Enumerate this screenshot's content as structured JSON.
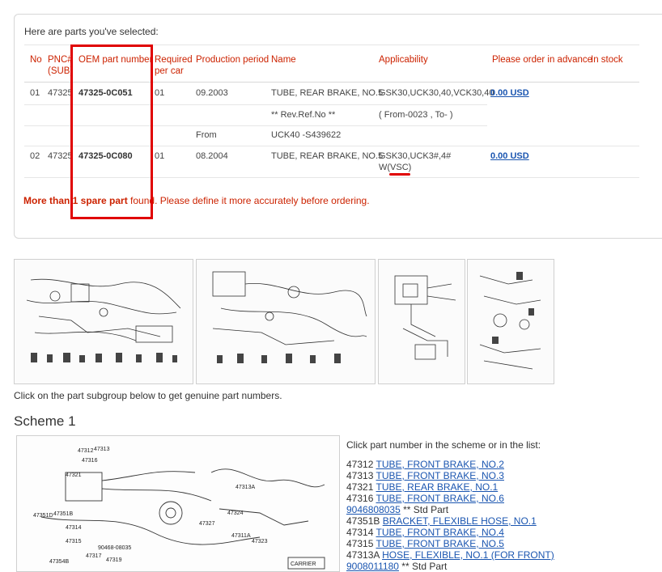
{
  "intro": "Here are parts you've selected:",
  "headers": {
    "no": "No",
    "pnc": "PNC#\n(SUB)",
    "oem": "OEM part number",
    "required": "Required\nper car",
    "period": "Production period",
    "name": "Name",
    "applicability": "Applicability",
    "order": "Please order in advance",
    "stock": "In stock"
  },
  "rows": [
    {
      "no": "01",
      "pnc": "47325",
      "oem": "47325-0C051",
      "req": "01",
      "period": "09.2003",
      "name": "TUBE, REAR BRAKE, NO.5",
      "app": "GSK30,UCK30,40,VCK30,40",
      "price": "0.00 USD"
    },
    {
      "sub_name": "** Rev.Ref.No **",
      "sub_app": "( From-0023 , To- )"
    },
    {
      "sub_period": "From",
      "sub_name": "UCK40 -S439622"
    },
    {
      "no": "02",
      "pnc": "47325",
      "oem": "47325-0C080",
      "req": "01",
      "period": "08.2004",
      "name": "TUBE, REAR BRAKE, NO.5",
      "app1": "GSK30,UCK3#,4#",
      "app2": "W(VSC)",
      "price": "0.00 USD"
    }
  ],
  "warning": {
    "bold": "More than 1 spare part",
    "rest": " found. Please define it more accurately before ordering."
  },
  "thumb_note": "Click on the part subgroup below to get genuine part numbers.",
  "scheme_title": "Scheme 1",
  "list_intro": "Click part number in the scheme or in the list:",
  "parts": [
    {
      "num": "47312",
      "link": "TUBE, FRONT BRAKE, NO.2"
    },
    {
      "num": "47313",
      "link": "TUBE, FRONT BRAKE, NO.3"
    },
    {
      "num": "47321",
      "link": "TUBE, REAR BRAKE, NO.1"
    },
    {
      "num": "47316",
      "link": "TUBE, FRONT BRAKE, NO.6"
    },
    {
      "num": "",
      "link": "9046808035",
      "std": " ** Std Part"
    },
    {
      "num": "47351B",
      "link": "BRACKET, FLEXIBLE HOSE, NO.1"
    },
    {
      "num": "47314",
      "link": "TUBE, FRONT BRAKE, NO.4"
    },
    {
      "num": "47315",
      "link": "TUBE, FRONT BRAKE, NO.5"
    },
    {
      "num": "47313A",
      "link": "HOSE, FLEXIBLE, NO.1 (FOR FRONT)"
    },
    {
      "num": "",
      "link": "9008011180",
      "std": " ** Std Part"
    }
  ],
  "scheme_labels": [
    "47312",
    "47313",
    "47316",
    "47321",
    "47351D",
    "47351B",
    "47314",
    "47315",
    "90468-08035",
    "47313A",
    "47324",
    "47327",
    "47311A",
    "47323",
    "47354B",
    "47317",
    "47319",
    "CARRIER"
  ],
  "colors": {
    "header_red": "#cc2200",
    "link_blue": "#1a55b0",
    "highlight_red": "#e00000"
  }
}
